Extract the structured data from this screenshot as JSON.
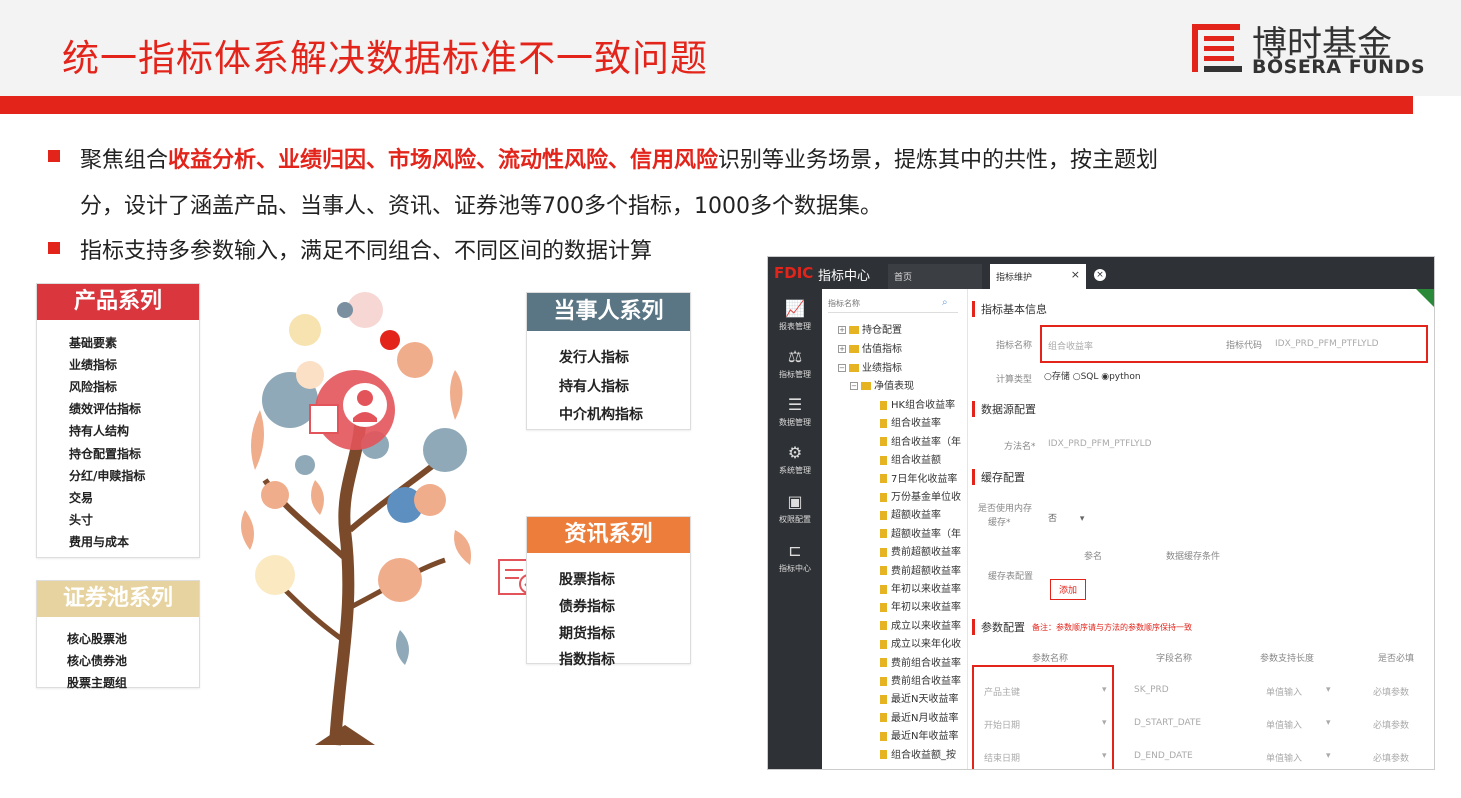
{
  "header": {
    "title": "统一指标体系解决数据标准不一致问题",
    "logo_cn": "博时基金",
    "logo_en": "BOSERA FUNDS"
  },
  "bullets": {
    "b1_pre": "聚焦组合",
    "b1_highlight": "收益分析、业绩归因、市场风险、流动性风险、信用风险",
    "b1_post": "识别等业务场景，提炼其中的共性，按主题划",
    "b1_line2": "分，设计了涵盖产品、当事人、资讯、证券池等700多个指标，1000多个数据集。",
    "b2": "指标支持多参数输入，满足不同组合、不同区间的数据计算"
  },
  "product": {
    "title": "产品系列",
    "items": [
      "基础要素",
      "业绩指标",
      "风险指标",
      "绩效评估指标",
      "持有人结构",
      "持仓配置指标",
      "分红/申赎指标",
      "交易",
      "头寸",
      "费用与成本"
    ]
  },
  "party": {
    "title": "当事人系列",
    "items": [
      "发行人指标",
      "持有人指标",
      "中介机构指标"
    ]
  },
  "info": {
    "title": "资讯系列",
    "items": [
      "股票指标",
      "债券指标",
      "期货指标",
      "指数指标"
    ]
  },
  "pool": {
    "title": "证券池系列",
    "items": [
      "核心股票池",
      "核心债券池",
      "股票主题组"
    ]
  },
  "colors": {
    "accent": "#e3241b",
    "product": "#d9363e",
    "party": "#5a7584",
    "info": "#ed7d3a",
    "pool": "#e7d3a0"
  },
  "app": {
    "brand": "FDIC",
    "brand_cn": "指标中心",
    "tab_home": "首页",
    "tab_active": "指标维护",
    "tab_close": "×",
    "nav": [
      {
        "icon": "line-chart-icon",
        "glyph": "📈",
        "label": "报表管理"
      },
      {
        "icon": "scale-icon",
        "glyph": "⚖",
        "label": "指标管理"
      },
      {
        "icon": "list-icon",
        "glyph": "☰",
        "label": "数据管理"
      },
      {
        "icon": "gear-icon",
        "glyph": "⚙",
        "label": "系统管理"
      },
      {
        "icon": "image-icon",
        "glyph": "▣",
        "label": "权限配置"
      },
      {
        "icon": "tree-icon",
        "glyph": "⊏",
        "label": "指标中心"
      }
    ],
    "search_placeholder": "指标名称",
    "tree_roots": [
      "持仓配置",
      "估值指标",
      "业绩指标"
    ],
    "tree_sub": "净值表现",
    "tree_items": [
      "HK组合收益率",
      "组合收益率",
      "组合收益率（年",
      "组合收益额",
      "7日年化收益率",
      "万份基金单位收",
      "超额收益率",
      "超额收益率（年",
      "费前超额收益率",
      "费前超额收益率",
      "年初以来收益率",
      "年初以来收益率",
      "成立以来收益率",
      "成立以来年化收",
      "费前组合收益率",
      "费前组合收益率",
      "最近N天收益率",
      "最近N月收益率",
      "最近N年收益率",
      "组合收益额_按"
    ],
    "sec_basic": "指标基本信息",
    "lbl_name": "指标名称",
    "val_name": "组合收益率",
    "lbl_code": "指标代码",
    "val_code": "IDX_PRD_PFM_PTFLYLD",
    "lbl_calc": "计算类型",
    "calc_opts": "○存储 ○SQL ◉python",
    "sec_source": "数据源配置",
    "lbl_method": "方法名*",
    "val_method": "IDX_PRD_PFM_PTFLYLD",
    "sec_cache": "缓存配置",
    "lbl_mem": "是否使用内存",
    "lbl_mem2": "缓存*",
    "val_mem": "否",
    "col_param": "参名",
    "col_cond": "数据缓存条件",
    "lbl_cache_table": "缓存表配置",
    "btn_add": "添加",
    "sec_param": "参数配置",
    "note": "备注：参数顺序请与方法的参数顺序保持一致",
    "param_headers": [
      "参数名称",
      "字段名称",
      "参数支持长度",
      "是否必填"
    ],
    "params": [
      {
        "name": "产品主键",
        "field": "SK_PRD",
        "len": "单值输入",
        "req": "必填参数"
      },
      {
        "name": "开始日期",
        "field": "D_START_DATE",
        "len": "单值输入",
        "req": "必填参数"
      },
      {
        "name": "结束日期",
        "field": "D_END_DATE",
        "len": "单值输入",
        "req": "必填参数"
      }
    ]
  }
}
